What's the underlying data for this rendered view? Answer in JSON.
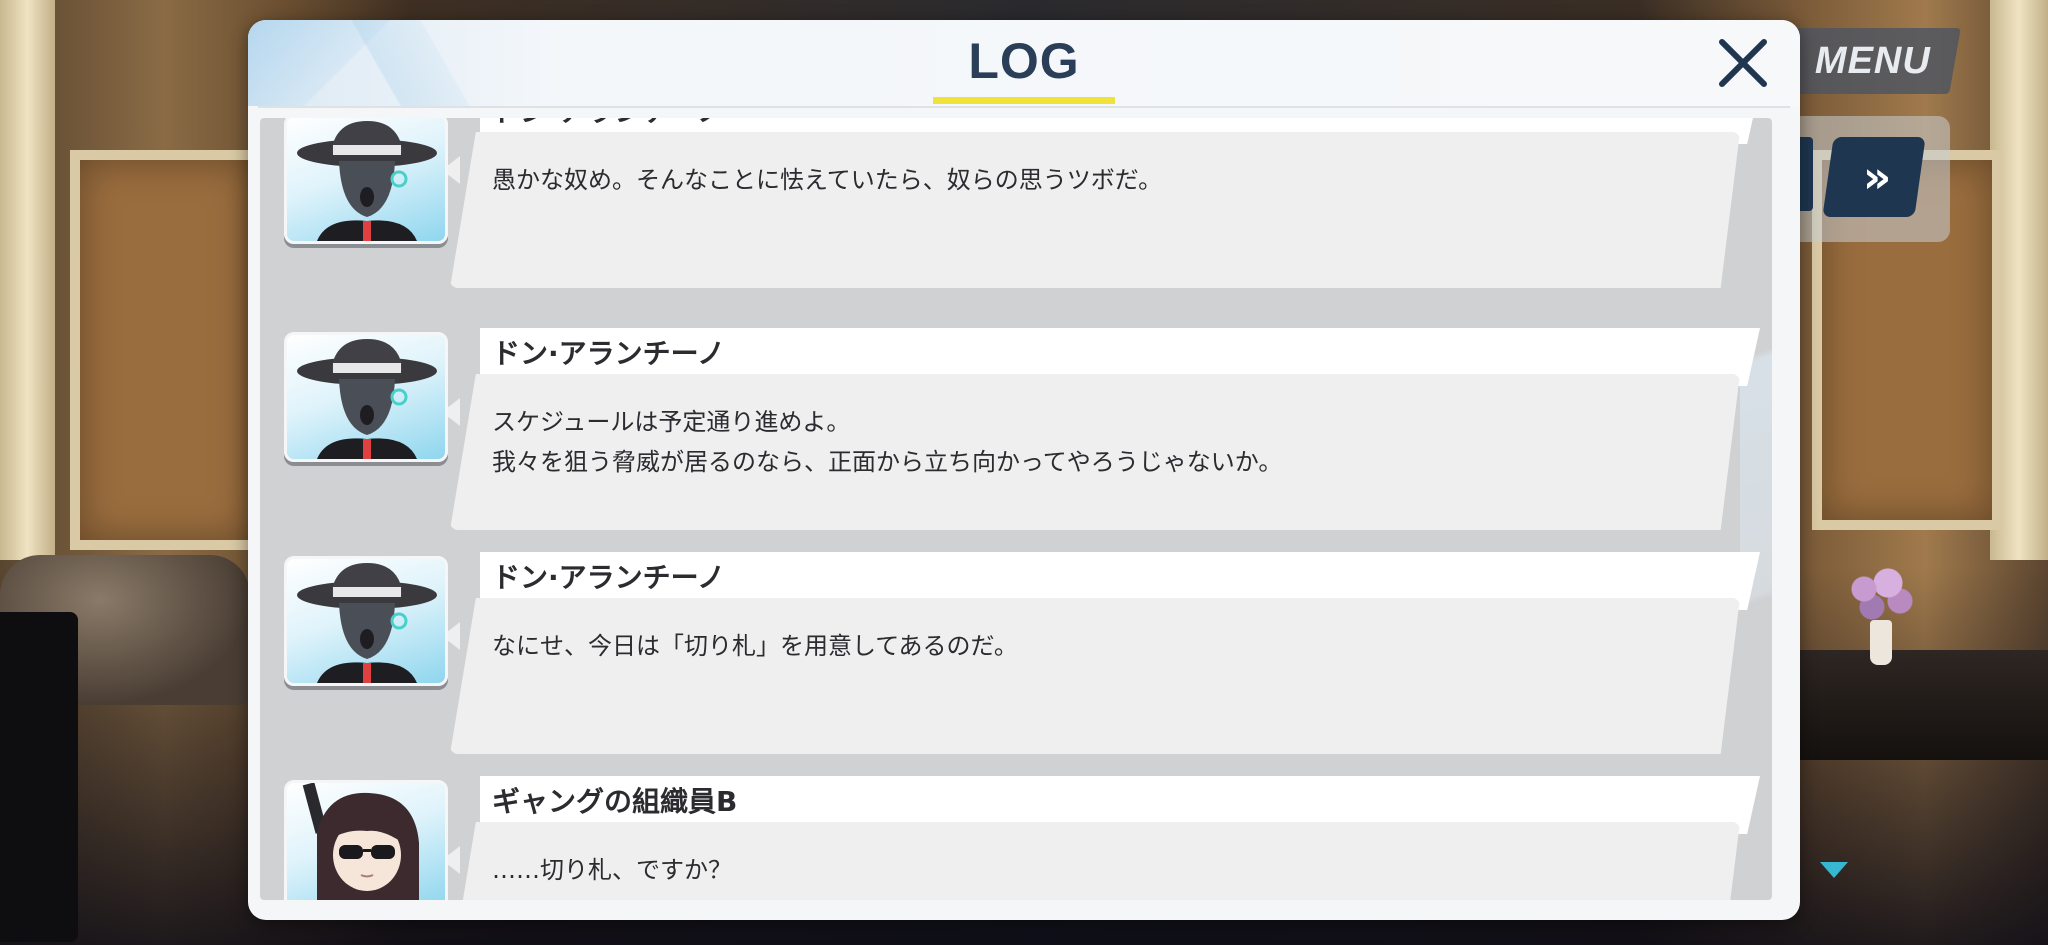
{
  "hud": {
    "menu_label": "MENU",
    "fast_forward_label": "»"
  },
  "dialog": {
    "title": "LOG",
    "close_label": "✕",
    "entries": [
      {
        "speaker": "ドン·アランチーノ",
        "text": "愚かな奴め。そんなことに怯えていたら、奴らの思うツボだ。",
        "portrait": "don-arancino-portrait"
      },
      {
        "speaker": "ドン·アランチーノ",
        "text": "スケジュールは予定通り進めよ。\n我々を狙う脅威が居るのなら、正面から立ち向かってやろうじゃないか。",
        "portrait": "don-arancino-portrait"
      },
      {
        "speaker": "ドン·アランチーノ",
        "text": "なにせ、今日は「切り札」を用意してあるのだ。",
        "portrait": "don-arancino-portrait"
      },
      {
        "speaker": "ギャングの組織員B",
        "text": "……切り札、ですか？",
        "portrait": "gang-member-b-portrait"
      }
    ]
  },
  "colors": {
    "title": "#2a3e58",
    "title_underline": "#f0e23a",
    "hud_dark": "#1e3650",
    "scroll_indicator": "#36b8d0"
  }
}
